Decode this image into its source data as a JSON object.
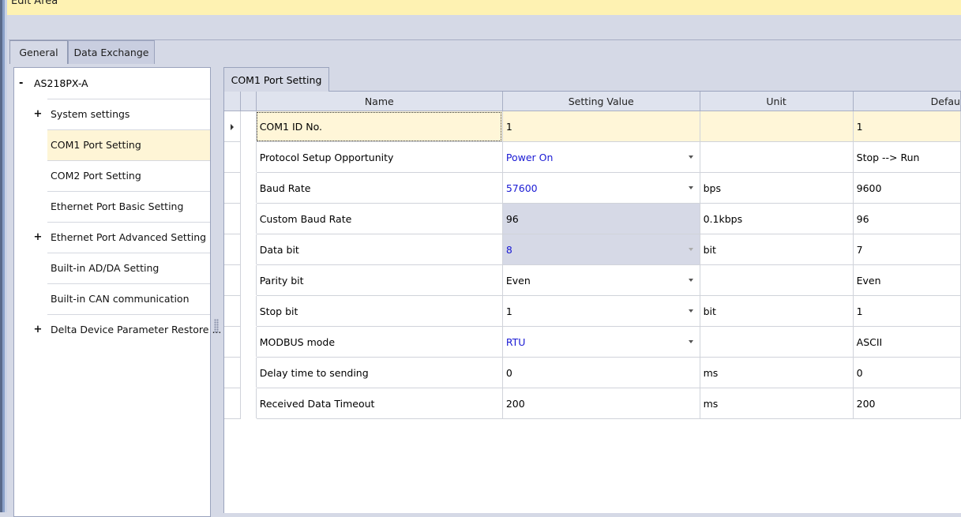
{
  "window": {
    "title": "Edit Area"
  },
  "tabs": {
    "general": "General",
    "data_exchange": "Data Exchange"
  },
  "tree": {
    "root": {
      "label": "AS218PX-A",
      "expander": "-"
    },
    "items": [
      {
        "label": "System settings",
        "expander": "+"
      },
      {
        "label": "COM1 Port Setting",
        "expander": ""
      },
      {
        "label": "COM2 Port Setting",
        "expander": ""
      },
      {
        "label": "Ethernet Port Basic Setting",
        "expander": ""
      },
      {
        "label": "Ethernet Port Advanced Setting",
        "expander": "+"
      },
      {
        "label": "Built-in AD/DA Setting",
        "expander": ""
      },
      {
        "label": "Built-in CAN communication",
        "expander": ""
      },
      {
        "label": "Delta Device Parameter Restore ...",
        "expander": "+"
      }
    ]
  },
  "settings": {
    "tab_label": "COM1 Port Setting",
    "columns": [
      "Name",
      "Setting Value",
      "Unit",
      "Defau"
    ],
    "rows": [
      {
        "name": "COM1 ID No.",
        "value": "1",
        "unit": "",
        "default": "1"
      },
      {
        "name": "Protocol Setup Opportunity",
        "value": "Power On",
        "unit": "",
        "default": "Stop --> Run"
      },
      {
        "name": "Baud Rate",
        "value": "57600",
        "unit": "bps",
        "default": "9600"
      },
      {
        "name": "Custom Baud Rate",
        "value": "96",
        "unit": "0.1kbps",
        "default": "96"
      },
      {
        "name": "Data bit",
        "value": "8",
        "unit": "bit",
        "default": "7"
      },
      {
        "name": "Parity bit",
        "value": "Even",
        "unit": "",
        "default": "Even"
      },
      {
        "name": "Stop bit",
        "value": "1",
        "unit": "bit",
        "default": "1"
      },
      {
        "name": "MODBUS mode",
        "value": "RTU",
        "unit": "",
        "default": "ASCII"
      },
      {
        "name": "Delay time to sending",
        "value": "0",
        "unit": "ms",
        "default": "0"
      },
      {
        "name": "Received Data Timeout",
        "value": "200",
        "unit": "ms",
        "default": "200"
      }
    ]
  },
  "colors": {
    "title_bar": "#fef2b2",
    "selected_row": "#fff6d8",
    "changed_value": "#1a1ad4",
    "disabled_cell": "#d6d9e6"
  }
}
